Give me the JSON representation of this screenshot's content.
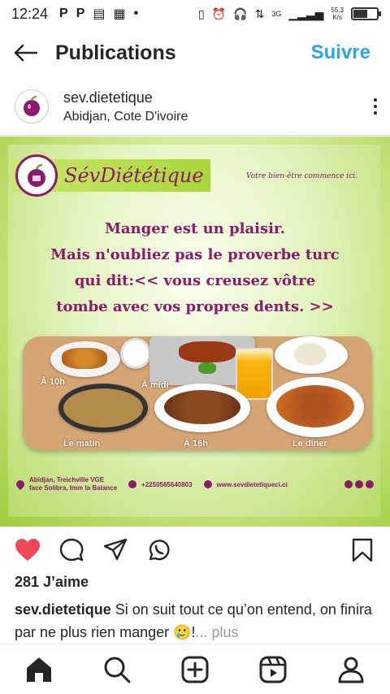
{
  "status_bar": {
    "time": "12:24",
    "notif_icons": [
      "P",
      "P",
      "▤",
      "▦",
      "•"
    ],
    "network": "3G",
    "speed": "55,3",
    "speed_unit": "K/s"
  },
  "header": {
    "title": "Publications",
    "follow_label": "Suivre"
  },
  "post": {
    "username": "sev.dietetique",
    "location": "Abidjan, Cote D'ivoire",
    "image": {
      "brand": "SévDiététique",
      "slogan": "Votre bien-être commence ici.",
      "quote_lines": [
        "Manger est un plaisir.",
        "Mais n'oubliez pas le proverbe turc",
        "qui dit:<< vous creusez vôtre",
        "tombe avec vos propres dents. >>"
      ],
      "meals": [
        "À 10h",
        "À midi",
        "Le matin",
        "À 16h",
        "Le dîner"
      ],
      "address_line1": "Abidjan, Treichville VGE",
      "address_line2": "face Solibra, Imm la Balance",
      "phone": "+2250565640803",
      "website": "www.sevdietetiqueci.ci"
    },
    "likes": "281 J’aime",
    "caption_user": "sev.dietetique",
    "caption_text": "Si on suit tout ce qu’on entend, on finira par ne plus rien manger 🥲!",
    "caption_more": "... plus"
  },
  "colors": {
    "accent": "#2aa4f4",
    "like": "#ed4956",
    "brand": "#8c1a6a"
  },
  "nav": [
    "home-icon",
    "search-icon",
    "create-icon",
    "reels-icon",
    "profile-icon"
  ]
}
